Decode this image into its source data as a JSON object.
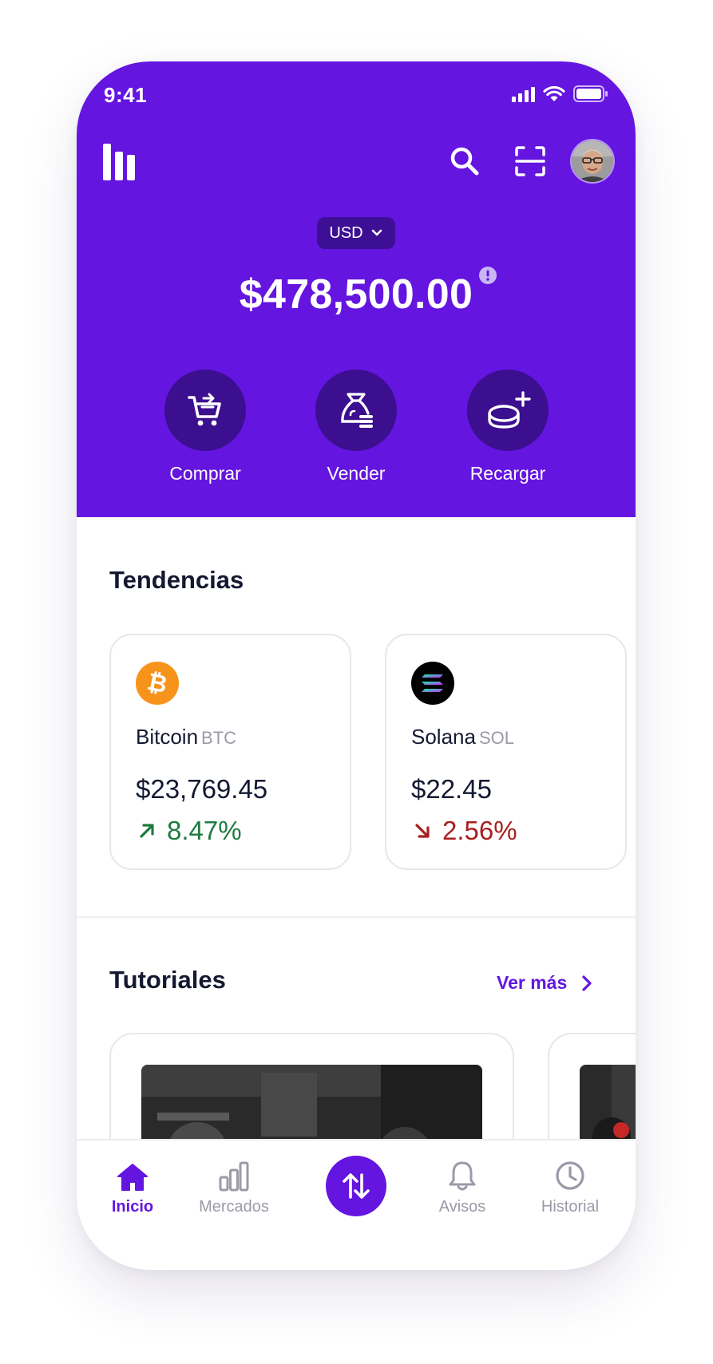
{
  "colors": {
    "brand": "#6415E0",
    "brand_dark": "#3B0F8F",
    "positive": "#1E7B3F",
    "negative": "#A81F1F",
    "text": "#141831",
    "muted": "#9A9AA8"
  },
  "status_bar": {
    "time": "9:41",
    "icons": [
      "cellular-icon",
      "wifi-icon",
      "battery-icon"
    ]
  },
  "top_bar": {
    "logo_icon": "bars-logo-icon",
    "actions": [
      "search-icon",
      "scan-icon",
      "avatar"
    ]
  },
  "wallet": {
    "currency": "USD",
    "balance": "$478,500.00",
    "info_icon": "info-icon"
  },
  "quick_actions": [
    {
      "label": "Comprar",
      "icon": "cart-icon"
    },
    {
      "label": "Vender",
      "icon": "money-bag-icon"
    },
    {
      "label": "Recargar",
      "icon": "coin-plus-icon"
    }
  ],
  "trends": {
    "title": "Tendencias",
    "items": [
      {
        "name": "Bitcoin",
        "ticker": "BTC",
        "price": "$23,769.45",
        "change": "8.47%",
        "direction": "up",
        "icon": "bitcoin-icon"
      },
      {
        "name": "Solana",
        "ticker": "SOL",
        "price": "$22.45",
        "change": "2.56%",
        "direction": "down",
        "icon": "solana-icon"
      }
    ]
  },
  "tutorials": {
    "title": "Tutoriales",
    "more_label": "Ver más"
  },
  "bottom_nav": {
    "items": [
      {
        "label": "Inicio",
        "icon": "home-icon",
        "active": true
      },
      {
        "label": "Mercados",
        "icon": "bar-chart-icon",
        "active": false
      },
      {
        "label": "Avisos",
        "icon": "bell-icon",
        "active": false
      },
      {
        "label": "Historial",
        "icon": "clock-icon",
        "active": false
      }
    ],
    "center_icon": "swap-arrows-icon"
  }
}
